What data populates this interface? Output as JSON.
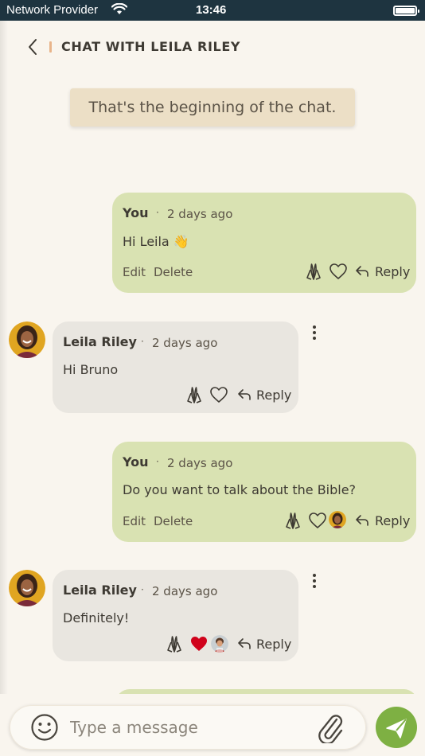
{
  "status_bar": {
    "carrier": "Network Provider",
    "time": "13:46"
  },
  "header": {
    "title": "CHAT WITH LEILA RILEY"
  },
  "banner": {
    "text": "That's the beginning of the chat."
  },
  "messages": [
    {
      "author": "You",
      "separator": "·",
      "time": "2 days ago",
      "text": "Hi Leila",
      "emoji": "👋",
      "edit": "Edit",
      "delete": "Delete",
      "reply": "Reply"
    },
    {
      "author": "Leila Riley",
      "separator": "·",
      "time": "2 days ago",
      "text": "Hi Bruno",
      "reply": "Reply"
    },
    {
      "author": "You",
      "separator": "·",
      "time": "2 days ago",
      "text": "Do you want to talk about the Bible?",
      "edit": "Edit",
      "delete": "Delete",
      "reply": "Reply"
    },
    {
      "author": "Leila Riley",
      "separator": "·",
      "time": "2 days ago",
      "text": "Definitely!",
      "reply": "Reply"
    }
  ],
  "composer": {
    "placeholder": "Type a message"
  },
  "colors": {
    "accent": "#7eb043",
    "my_bubble": "#d9e2b2",
    "their_bubble": "#e9e6e0",
    "heart_active": "#d0021b",
    "status_bar": "#1e3440"
  }
}
